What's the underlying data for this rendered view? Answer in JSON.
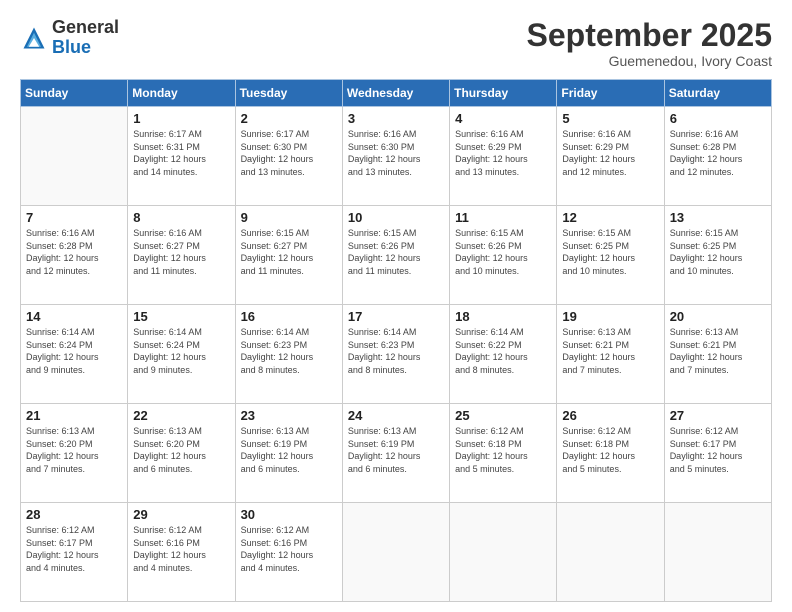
{
  "logo": {
    "general": "General",
    "blue": "Blue"
  },
  "title": "September 2025",
  "subtitle": "Guemenedou, Ivory Coast",
  "days_of_week": [
    "Sunday",
    "Monday",
    "Tuesday",
    "Wednesday",
    "Thursday",
    "Friday",
    "Saturday"
  ],
  "weeks": [
    [
      {
        "day": "",
        "info": ""
      },
      {
        "day": "1",
        "info": "Sunrise: 6:17 AM\nSunset: 6:31 PM\nDaylight: 12 hours\nand 14 minutes."
      },
      {
        "day": "2",
        "info": "Sunrise: 6:17 AM\nSunset: 6:30 PM\nDaylight: 12 hours\nand 13 minutes."
      },
      {
        "day": "3",
        "info": "Sunrise: 6:16 AM\nSunset: 6:30 PM\nDaylight: 12 hours\nand 13 minutes."
      },
      {
        "day": "4",
        "info": "Sunrise: 6:16 AM\nSunset: 6:29 PM\nDaylight: 12 hours\nand 13 minutes."
      },
      {
        "day": "5",
        "info": "Sunrise: 6:16 AM\nSunset: 6:29 PM\nDaylight: 12 hours\nand 12 minutes."
      },
      {
        "day": "6",
        "info": "Sunrise: 6:16 AM\nSunset: 6:28 PM\nDaylight: 12 hours\nand 12 minutes."
      }
    ],
    [
      {
        "day": "7",
        "info": "Sunrise: 6:16 AM\nSunset: 6:28 PM\nDaylight: 12 hours\nand 12 minutes."
      },
      {
        "day": "8",
        "info": "Sunrise: 6:16 AM\nSunset: 6:27 PM\nDaylight: 12 hours\nand 11 minutes."
      },
      {
        "day": "9",
        "info": "Sunrise: 6:15 AM\nSunset: 6:27 PM\nDaylight: 12 hours\nand 11 minutes."
      },
      {
        "day": "10",
        "info": "Sunrise: 6:15 AM\nSunset: 6:26 PM\nDaylight: 12 hours\nand 11 minutes."
      },
      {
        "day": "11",
        "info": "Sunrise: 6:15 AM\nSunset: 6:26 PM\nDaylight: 12 hours\nand 10 minutes."
      },
      {
        "day": "12",
        "info": "Sunrise: 6:15 AM\nSunset: 6:25 PM\nDaylight: 12 hours\nand 10 minutes."
      },
      {
        "day": "13",
        "info": "Sunrise: 6:15 AM\nSunset: 6:25 PM\nDaylight: 12 hours\nand 10 minutes."
      }
    ],
    [
      {
        "day": "14",
        "info": "Sunrise: 6:14 AM\nSunset: 6:24 PM\nDaylight: 12 hours\nand 9 minutes."
      },
      {
        "day": "15",
        "info": "Sunrise: 6:14 AM\nSunset: 6:24 PM\nDaylight: 12 hours\nand 9 minutes."
      },
      {
        "day": "16",
        "info": "Sunrise: 6:14 AM\nSunset: 6:23 PM\nDaylight: 12 hours\nand 8 minutes."
      },
      {
        "day": "17",
        "info": "Sunrise: 6:14 AM\nSunset: 6:23 PM\nDaylight: 12 hours\nand 8 minutes."
      },
      {
        "day": "18",
        "info": "Sunrise: 6:14 AM\nSunset: 6:22 PM\nDaylight: 12 hours\nand 8 minutes."
      },
      {
        "day": "19",
        "info": "Sunrise: 6:13 AM\nSunset: 6:21 PM\nDaylight: 12 hours\nand 7 minutes."
      },
      {
        "day": "20",
        "info": "Sunrise: 6:13 AM\nSunset: 6:21 PM\nDaylight: 12 hours\nand 7 minutes."
      }
    ],
    [
      {
        "day": "21",
        "info": "Sunrise: 6:13 AM\nSunset: 6:20 PM\nDaylight: 12 hours\nand 7 minutes."
      },
      {
        "day": "22",
        "info": "Sunrise: 6:13 AM\nSunset: 6:20 PM\nDaylight: 12 hours\nand 6 minutes."
      },
      {
        "day": "23",
        "info": "Sunrise: 6:13 AM\nSunset: 6:19 PM\nDaylight: 12 hours\nand 6 minutes."
      },
      {
        "day": "24",
        "info": "Sunrise: 6:13 AM\nSunset: 6:19 PM\nDaylight: 12 hours\nand 6 minutes."
      },
      {
        "day": "25",
        "info": "Sunrise: 6:12 AM\nSunset: 6:18 PM\nDaylight: 12 hours\nand 5 minutes."
      },
      {
        "day": "26",
        "info": "Sunrise: 6:12 AM\nSunset: 6:18 PM\nDaylight: 12 hours\nand 5 minutes."
      },
      {
        "day": "27",
        "info": "Sunrise: 6:12 AM\nSunset: 6:17 PM\nDaylight: 12 hours\nand 5 minutes."
      }
    ],
    [
      {
        "day": "28",
        "info": "Sunrise: 6:12 AM\nSunset: 6:17 PM\nDaylight: 12 hours\nand 4 minutes."
      },
      {
        "day": "29",
        "info": "Sunrise: 6:12 AM\nSunset: 6:16 PM\nDaylight: 12 hours\nand 4 minutes."
      },
      {
        "day": "30",
        "info": "Sunrise: 6:12 AM\nSunset: 6:16 PM\nDaylight: 12 hours\nand 4 minutes."
      },
      {
        "day": "",
        "info": ""
      },
      {
        "day": "",
        "info": ""
      },
      {
        "day": "",
        "info": ""
      },
      {
        "day": "",
        "info": ""
      }
    ]
  ]
}
